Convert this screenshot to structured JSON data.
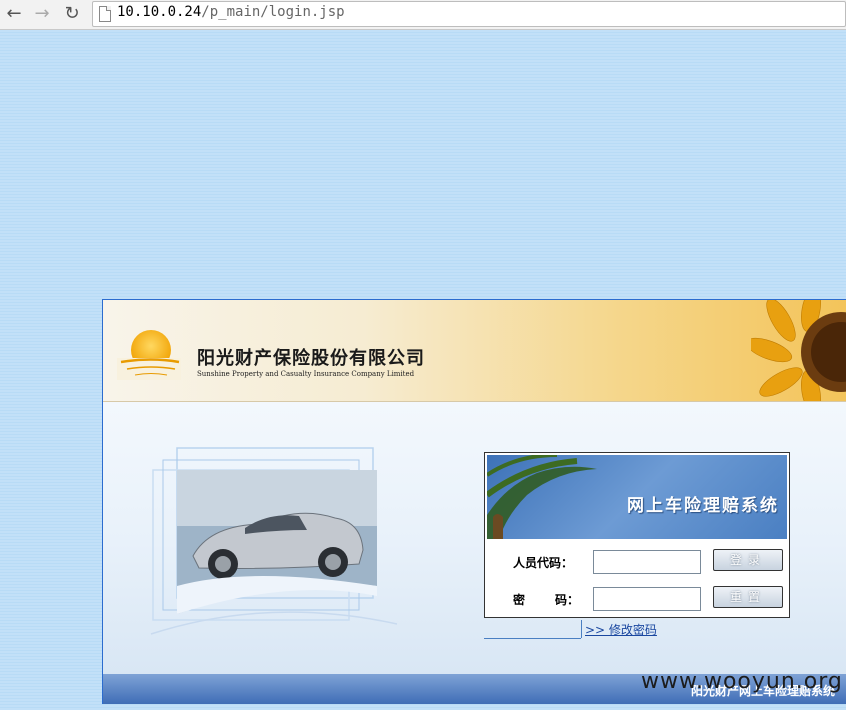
{
  "browser": {
    "url_host": "10.10.0.24",
    "url_path": "/p_main/login.jsp"
  },
  "header": {
    "company_cn": "阳光财产保险股份有限公司",
    "company_en": "Sunshine Property and Casualty Insurance Company Limited"
  },
  "login": {
    "banner_title": "网上车险理赔系统",
    "user_label": "人员代码：",
    "password_label_a": "密",
    "password_label_b": "码：",
    "user_value": "",
    "password_value": "",
    "login_button": "登录",
    "reset_button": "重置",
    "change_password_link": ">> 修改密码"
  },
  "footer": {
    "text": "阳光财产网上车险理赔系统"
  },
  "watermark": "www.wooyun.org",
  "colors": {
    "frame_border": "#2b6ccf",
    "header_gold": "#f3c45a",
    "banner_blue": "#3d72b8",
    "footer_blue": "#3f6db6",
    "link_blue": "#1a47a0"
  }
}
